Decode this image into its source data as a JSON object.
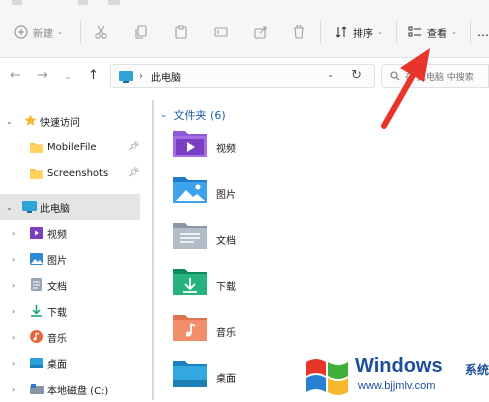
{
  "toolbar": {
    "new_label": "新建",
    "sort_label": "排序",
    "view_label": "查看"
  },
  "address": {
    "path_label": "此电脑",
    "search_placeholder": "在 此电脑 中搜索"
  },
  "sidebar": {
    "items": [
      {
        "label": "快速访问",
        "icon": "star-icon"
      },
      {
        "label": "MobileFile",
        "icon": "folder-icon"
      },
      {
        "label": "Screenshots",
        "icon": "folder-icon"
      },
      {
        "label": "此电脑",
        "icon": "pc-icon"
      },
      {
        "label": "视频",
        "icon": "video-icon"
      },
      {
        "label": "图片",
        "icon": "picture-icon"
      },
      {
        "label": "文档",
        "icon": "document-icon"
      },
      {
        "label": "下载",
        "icon": "download-icon"
      },
      {
        "label": "音乐",
        "icon": "music-icon"
      },
      {
        "label": "桌面",
        "icon": "desktop-icon"
      },
      {
        "label": "本地磁盘 (C:)",
        "icon": "drive-icon"
      }
    ]
  },
  "content": {
    "group_title": "文件夹 (6)",
    "folders": [
      {
        "label": "视频",
        "icon": "video-folder-icon"
      },
      {
        "label": "图片",
        "icon": "picture-folder-icon"
      },
      {
        "label": "文档",
        "icon": "document-folder-icon"
      },
      {
        "label": "下载",
        "icon": "download-folder-icon"
      },
      {
        "label": "音乐",
        "icon": "music-folder-icon"
      },
      {
        "label": "桌面",
        "icon": "desktop-folder-icon"
      }
    ]
  },
  "watermark": {
    "brand": "Windows",
    "suffix": "系统之家",
    "url": "www.bjjmlv.com"
  },
  "colors": {
    "accent": "#1f5fa8",
    "arrow": "#e8352c",
    "selected": "#e5e5e5"
  }
}
